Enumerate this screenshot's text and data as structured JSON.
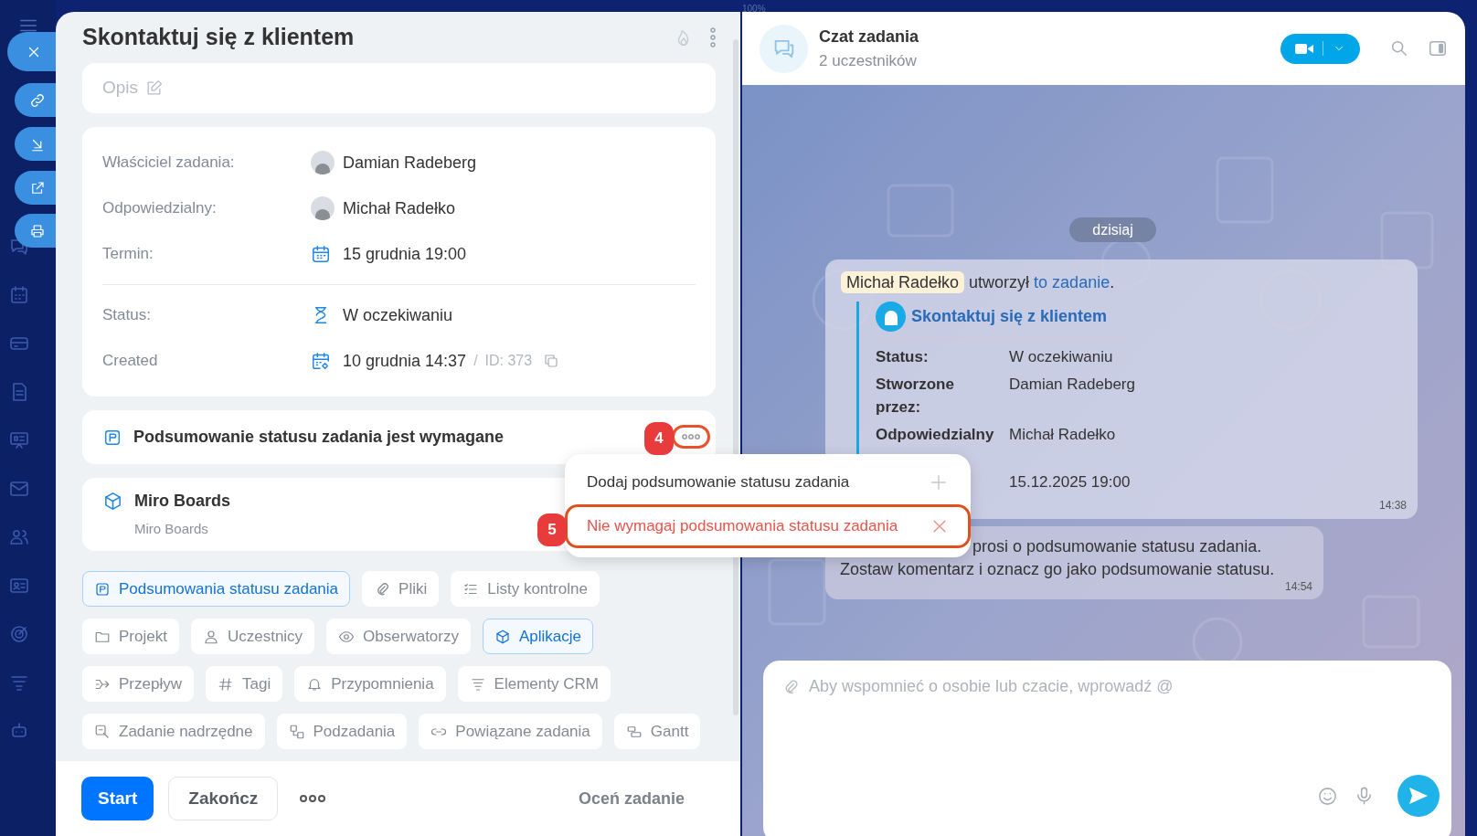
{
  "top_bar": {
    "zoom": "100%"
  },
  "task": {
    "title": "Skontaktuj się z klientem",
    "description_placeholder": "Opis",
    "fields": [
      {
        "kind": "person",
        "label": "Właściciel zadania:",
        "value": "Damian Radeberg"
      },
      {
        "kind": "person",
        "label": "Odpowiedzialny:",
        "value": "Michał Radełko"
      },
      {
        "kind": "date",
        "label": "Termin:",
        "value": "15 grudnia 19:00"
      },
      {
        "kind": "status",
        "label": "Status:",
        "value": "W oczekiwaniu"
      },
      {
        "kind": "created",
        "label": "Created",
        "value": "10 grudnia 14:37",
        "separator": "/",
        "id": "ID: 373"
      }
    ],
    "requirement": {
      "text": "Podsumowanie statusu zadania jest wymagane"
    },
    "app": {
      "title": "Miro Boards",
      "subtitle": "Miro Boards"
    },
    "chips": [
      {
        "label": "Podsumowania statusu zadania",
        "selected": true
      },
      {
        "label": "Pliki",
        "selected": false
      },
      {
        "label": "Listy kontrolne",
        "selected": false
      },
      {
        "label": "Projekt",
        "selected": false
      },
      {
        "label": "Uczestnicy",
        "selected": false
      },
      {
        "label": "Obserwatorzy",
        "selected": false
      },
      {
        "label": "Aplikacje",
        "selected": true
      },
      {
        "label": "Przepływ",
        "selected": false
      },
      {
        "label": "Tagi",
        "selected": false
      },
      {
        "label": "Przypomnienia",
        "selected": false
      },
      {
        "label": "Elementy CRM",
        "selected": false
      },
      {
        "label": "Zadanie nadrzędne",
        "selected": false
      },
      {
        "label": "Podzadania",
        "selected": false
      },
      {
        "label": "Powiązane zadania",
        "selected": false
      },
      {
        "label": "Gantt",
        "selected": false
      }
    ],
    "footer": {
      "primary": "Start",
      "secondary": "Zakończ",
      "rate": "Oceń zadanie"
    }
  },
  "menu": {
    "items": [
      {
        "kind": "add",
        "label": "Dodaj podsumowanie statusu zadania",
        "highlighted": false
      },
      {
        "kind": "remove",
        "label": "Nie wymagaj podsumowania statusu zadania",
        "highlighted": true
      }
    ]
  },
  "callouts": [
    {
      "number": "4"
    },
    {
      "number": "5"
    }
  ],
  "chat": {
    "title": "Czat zadania",
    "subtitle": "2 uczestników",
    "date_divider": "dzisiaj",
    "messages": [
      {
        "kind": "task_card",
        "author": "Michał Radełko",
        "action": "utworzył",
        "link": "to zadanie",
        "trailing": ".",
        "card_title": "Skontaktuj się z klientem",
        "fields": [
          {
            "label": "Status:",
            "value": "W oczekiwaniu"
          },
          {
            "label": "Stworzone przez:",
            "value": "Damian Radeberg"
          },
          {
            "label": "Odpowiedzialny",
            "value": "Michał Radełko"
          },
          {
            "value": "15.12.2025 19:00"
          }
        ],
        "time": "14:38"
      },
      {
        "kind": "text",
        "lines": [
          "prosi o podsumowanie statusu zadania.",
          "Zostaw komentarz i oznacz go jako podsumowanie statusu."
        ],
        "time": "14:54"
      }
    ],
    "composer": {
      "placeholder": "Aby wspomnieć o osobie lub czacie, wprowadź @"
    }
  }
}
